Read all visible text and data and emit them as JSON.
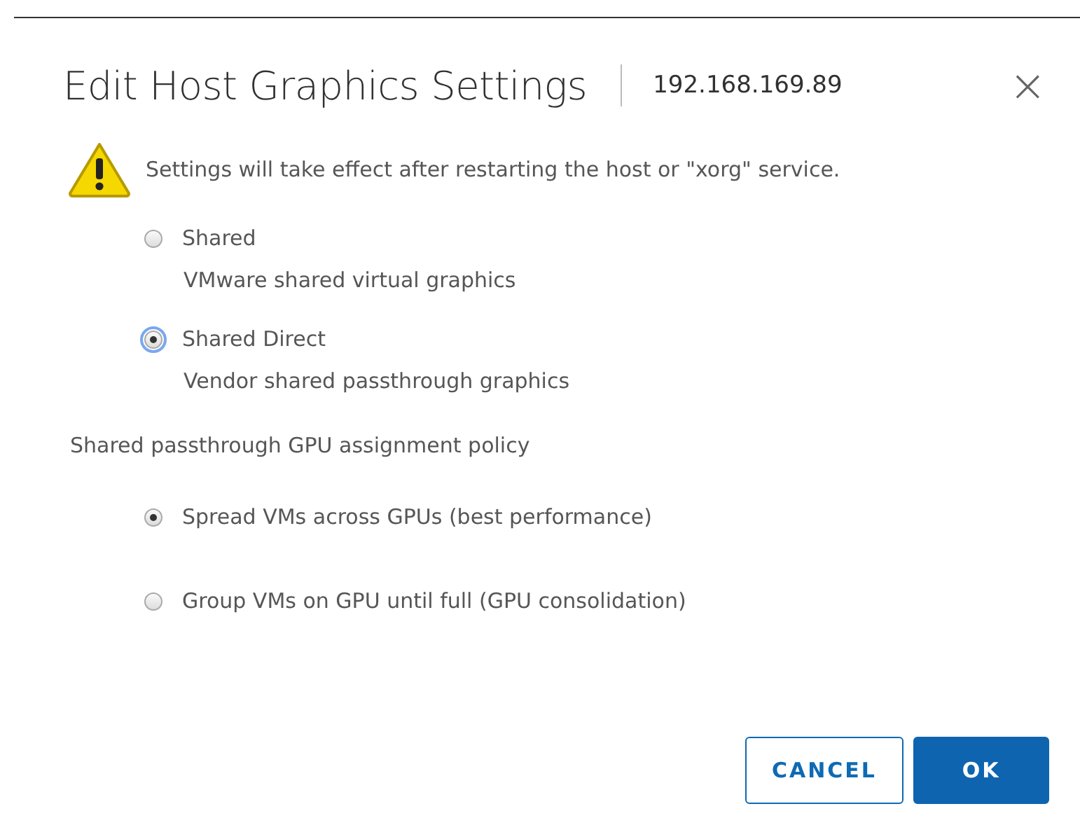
{
  "dialog": {
    "title": "Edit Host Graphics Settings",
    "host": "192.168.169.89",
    "close": "×"
  },
  "warning": "Settings will take effect after restarting the host or \"xorg\" service.",
  "graphics_types": [
    {
      "label": "Shared",
      "description": "VMware shared virtual graphics",
      "selected": false,
      "focused": false
    },
    {
      "label": "Shared Direct",
      "description": "Vendor shared passthrough graphics",
      "selected": true,
      "focused": true
    }
  ],
  "policy": {
    "label": "Shared passthrough GPU assignment policy",
    "options": [
      {
        "label": "Spread VMs across GPUs (best performance)",
        "selected": true
      },
      {
        "label": "Group VMs on GPU until full (GPU consolidation)",
        "selected": false
      }
    ]
  },
  "buttons": [
    {
      "label": "CANCEL",
      "kind": "secondary"
    },
    {
      "label": "OK",
      "kind": "primary"
    }
  ]
}
